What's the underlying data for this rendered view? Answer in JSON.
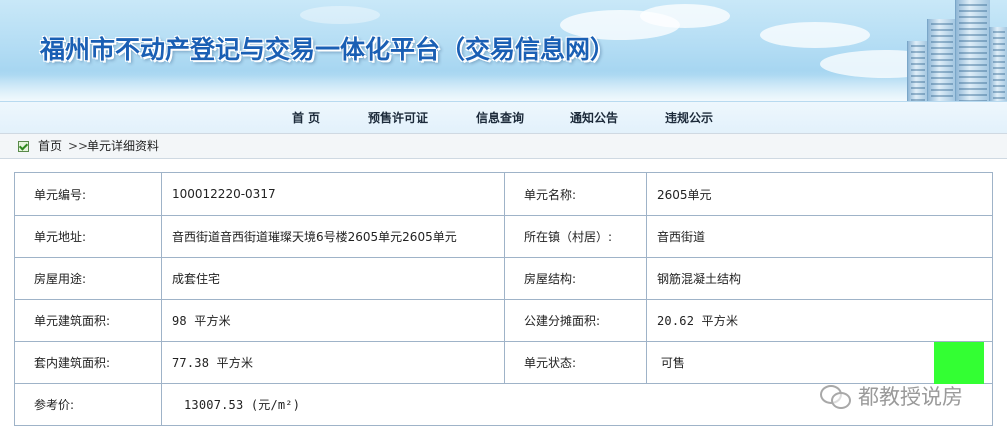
{
  "header": {
    "site_title": "福州市不动产登记与交易一体化平台（交易信息网）"
  },
  "nav": {
    "items": [
      {
        "label": "首 页"
      },
      {
        "label": "预售许可证"
      },
      {
        "label": "信息查询"
      },
      {
        "label": "通知公告"
      },
      {
        "label": "违规公示"
      }
    ]
  },
  "breadcrumb": {
    "home": "首页",
    "separator": ">>",
    "current": "单元详细资料"
  },
  "detail": {
    "rows": [
      {
        "label1": "单元编号:",
        "value1": "100012220-0317",
        "label2": "单元名称:",
        "value2": "2605单元"
      },
      {
        "label1": "单元地址:",
        "value1": "音西街道音西街道璀璨天境6号楼2605单元2605单元",
        "label2": "所在镇（村居）:",
        "value2": "音西街道"
      },
      {
        "label1": "房屋用途:",
        "value1": "成套住宅",
        "label2": "房屋结构:",
        "value2": "钢筋混凝土结构"
      },
      {
        "label1": "单元建筑面积:",
        "value1": "98 平方米",
        "label2": "公建分摊面积:",
        "value2": "20.62 平方米"
      },
      {
        "label1": "套内建筑面积:",
        "value1": "77.38 平方米",
        "label2": "单元状态:",
        "value2": " 可售"
      }
    ],
    "price_label": "参考价:",
    "price_value": "13007.53 (元/m²)",
    "status_color": "#33ff33"
  },
  "watermark": {
    "text": "都教授说房"
  },
  "colors": {
    "title_blue": "#1a5fb4",
    "table_border": "#9fb3c8"
  }
}
